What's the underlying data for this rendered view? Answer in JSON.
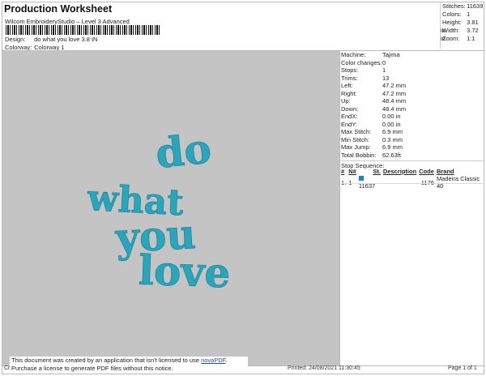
{
  "header": {
    "title": "Production Worksheet",
    "software": "Wilcom EmbroideryStudio – Level 3 Advanced",
    "design_label": "Design:",
    "design_value": "do what you love 3.8 IN",
    "colorway_label": "Colorway:",
    "colorway_value": "Colorway 1"
  },
  "stats": [
    {
      "label": "Stitches:",
      "value": "11639"
    },
    {
      "label": "Colors:",
      "value": "1"
    },
    {
      "label": "Height:",
      "value": "3.81 in"
    },
    {
      "label": "Width:",
      "value": "3.72 in"
    },
    {
      "label": "Zoom:",
      "value": "1:1"
    }
  ],
  "design": {
    "lines": [
      "do",
      "what",
      "you",
      "love"
    ],
    "thread_color": "#2aa5bb",
    "background": "#c4c4c4"
  },
  "info": [
    {
      "label": "Machine:",
      "value": "Tajima"
    },
    {
      "label": "Color changes:",
      "value": "0"
    },
    {
      "label": "Stops:",
      "value": "1"
    },
    {
      "label": "Trims:",
      "value": "13"
    },
    {
      "label": "Left:",
      "value": "47.2 mm"
    },
    {
      "label": "Right:",
      "value": "47.2 mm"
    },
    {
      "label": "Up:",
      "value": "48.4 mm"
    },
    {
      "label": "Down:",
      "value": "48.4 mm"
    },
    {
      "label": "EndX:",
      "value": "0.00 in"
    },
    {
      "label": "EndY:",
      "value": "0.00 in"
    },
    {
      "label": "Max Stitch:",
      "value": "6.9 mm"
    },
    {
      "label": "Min Stitch:",
      "value": "0.3 mm"
    },
    {
      "label": "Max Jump:",
      "value": "6.9 mm"
    },
    {
      "label": "Total Bobbin:",
      "value": "62.63ft"
    }
  ],
  "stop_sequence": {
    "title": "Stop Sequence:",
    "headers": [
      "#",
      "N#",
      "St.",
      "Description",
      "Code",
      "Brand"
    ],
    "rows": [
      {
        "num": "1.",
        "n": "1",
        "color": "#1a86c8",
        "st": "11637",
        "description": "",
        "code": "1176",
        "brand": "Madeira Classic 40"
      }
    ]
  },
  "notice": {
    "line1": "This document was created by an application that isn't licensed to use",
    "link": "novaPDF",
    "line2": "Purchase a license to generate PDF files without this notice."
  },
  "footer": {
    "left": "Cr",
    "printed": "Printed: 24/08/2021 11:30:45",
    "page": "Page 1 of 1"
  }
}
